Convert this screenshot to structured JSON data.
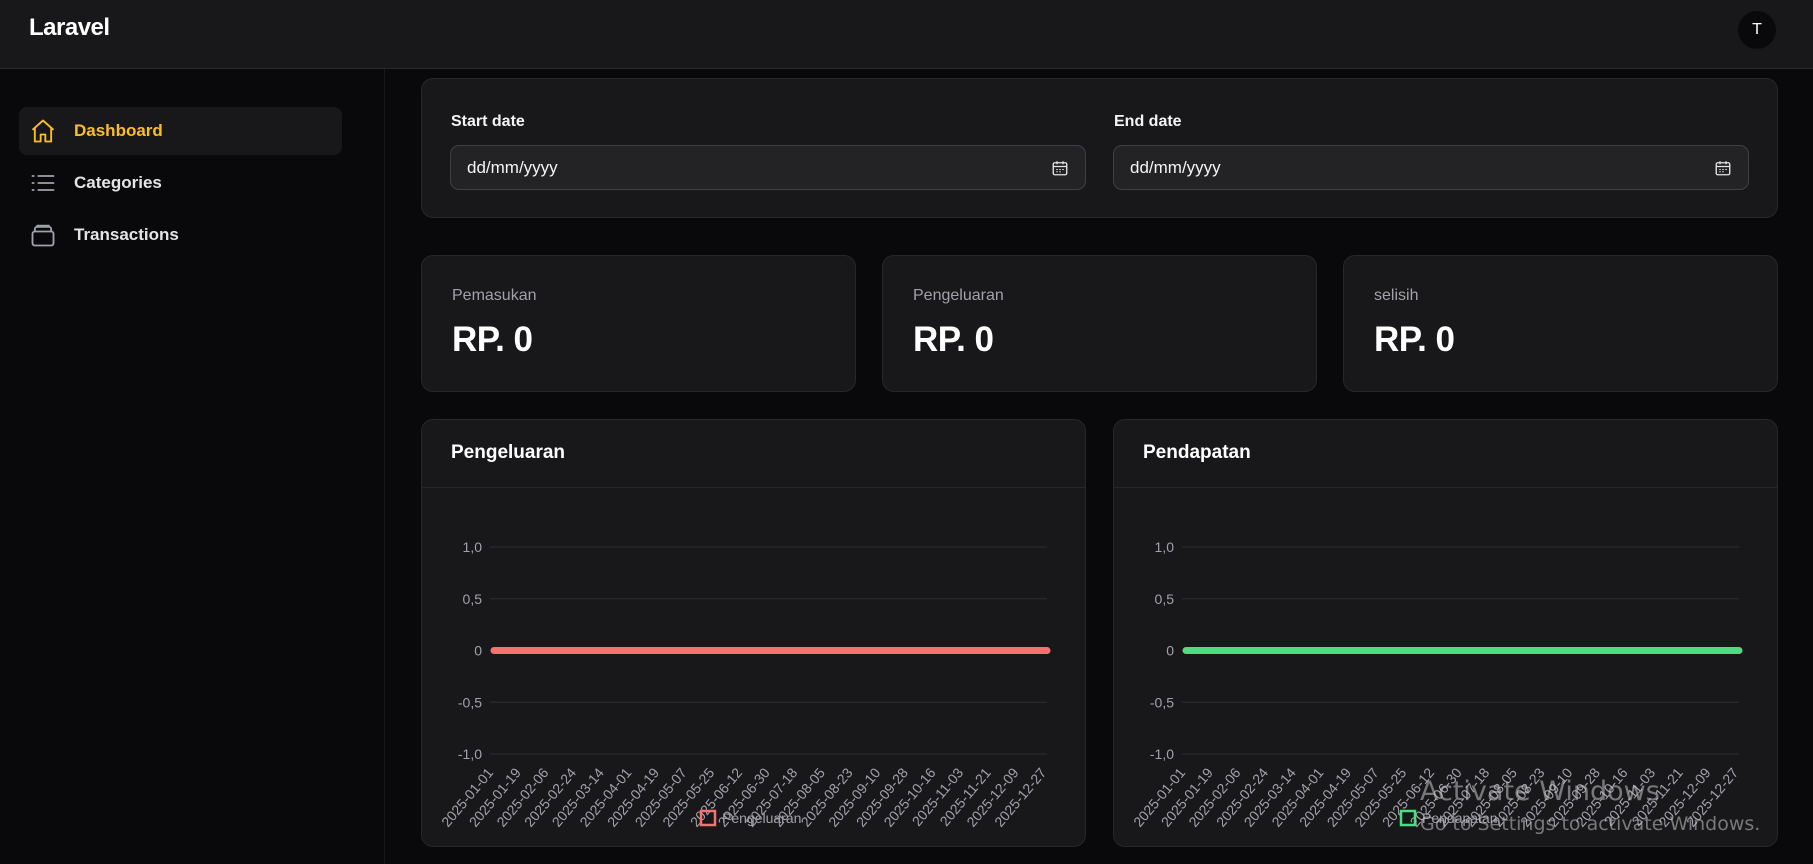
{
  "app": {
    "brand": "Laravel",
    "avatar_initial": "T"
  },
  "sidebar": {
    "items": [
      {
        "label": "Dashboard",
        "icon": "home-icon",
        "active": true
      },
      {
        "label": "Categories",
        "icon": "list-icon",
        "active": false
      },
      {
        "label": "Transactions",
        "icon": "wallet-icon",
        "active": false
      }
    ]
  },
  "filters": {
    "start_label": "Start date",
    "start_placeholder": "dd/mm/yyyy",
    "end_label": "End date",
    "end_placeholder": "dd/mm/yyyy"
  },
  "stats": [
    {
      "label": "Pemasukan",
      "value": "RP. 0"
    },
    {
      "label": "Pengeluaran",
      "value": "RP. 0"
    },
    {
      "label": "selisih",
      "value": "RP. 0"
    }
  ],
  "colors": {
    "accent": "#fbbf24",
    "expense": "#f87171",
    "income": "#4ade80"
  },
  "chart_data": [
    {
      "type": "line",
      "title": "Pengeluaran",
      "x": [
        "2025-01-01",
        "2025-01-19",
        "2025-02-06",
        "2025-02-24",
        "2025-03-14",
        "2025-04-01",
        "2025-04-19",
        "2025-05-07",
        "2025-05-25",
        "2025-06-12",
        "2025-06-30",
        "2025-07-18",
        "2025-08-05",
        "2025-08-23",
        "2025-09-10",
        "2025-09-28",
        "2025-10-16",
        "2025-11-03",
        "2025-11-21",
        "2025-12-09",
        "2025-12-27"
      ],
      "series": [
        {
          "name": "Pengeluaran",
          "values": [
            0,
            0,
            0,
            0,
            0,
            0,
            0,
            0,
            0,
            0,
            0,
            0,
            0,
            0,
            0,
            0,
            0,
            0,
            0,
            0,
            0
          ],
          "color": "#f87171"
        }
      ],
      "ylim": [
        -1.0,
        1.0
      ],
      "yticks": [
        "1,0",
        "0,5",
        "0",
        "-0,5",
        "-1,0"
      ],
      "grid": true,
      "legend": "bottom"
    },
    {
      "type": "line",
      "title": "Pendapatan",
      "x": [
        "2025-01-01",
        "2025-01-19",
        "2025-02-06",
        "2025-02-24",
        "2025-03-14",
        "2025-04-01",
        "2025-04-19",
        "2025-05-07",
        "2025-05-25",
        "2025-06-12",
        "2025-06-30",
        "2025-07-18",
        "2025-08-05",
        "2025-08-23",
        "2025-09-10",
        "2025-09-28",
        "2025-10-16",
        "2025-11-03",
        "2025-11-21",
        "2025-12-09",
        "2025-12-27"
      ],
      "series": [
        {
          "name": "Pendapatan",
          "values": [
            0,
            0,
            0,
            0,
            0,
            0,
            0,
            0,
            0,
            0,
            0,
            0,
            0,
            0,
            0,
            0,
            0,
            0,
            0,
            0,
            0
          ],
          "color": "#4ade80"
        }
      ],
      "ylim": [
        -1.0,
        1.0
      ],
      "yticks": [
        "1,0",
        "0,5",
        "0",
        "-0,5",
        "-1,0"
      ],
      "grid": true,
      "legend": "bottom"
    }
  ],
  "watermark": {
    "line1": "Activate Windows",
    "line2": "Go to Settings to activate Windows."
  }
}
